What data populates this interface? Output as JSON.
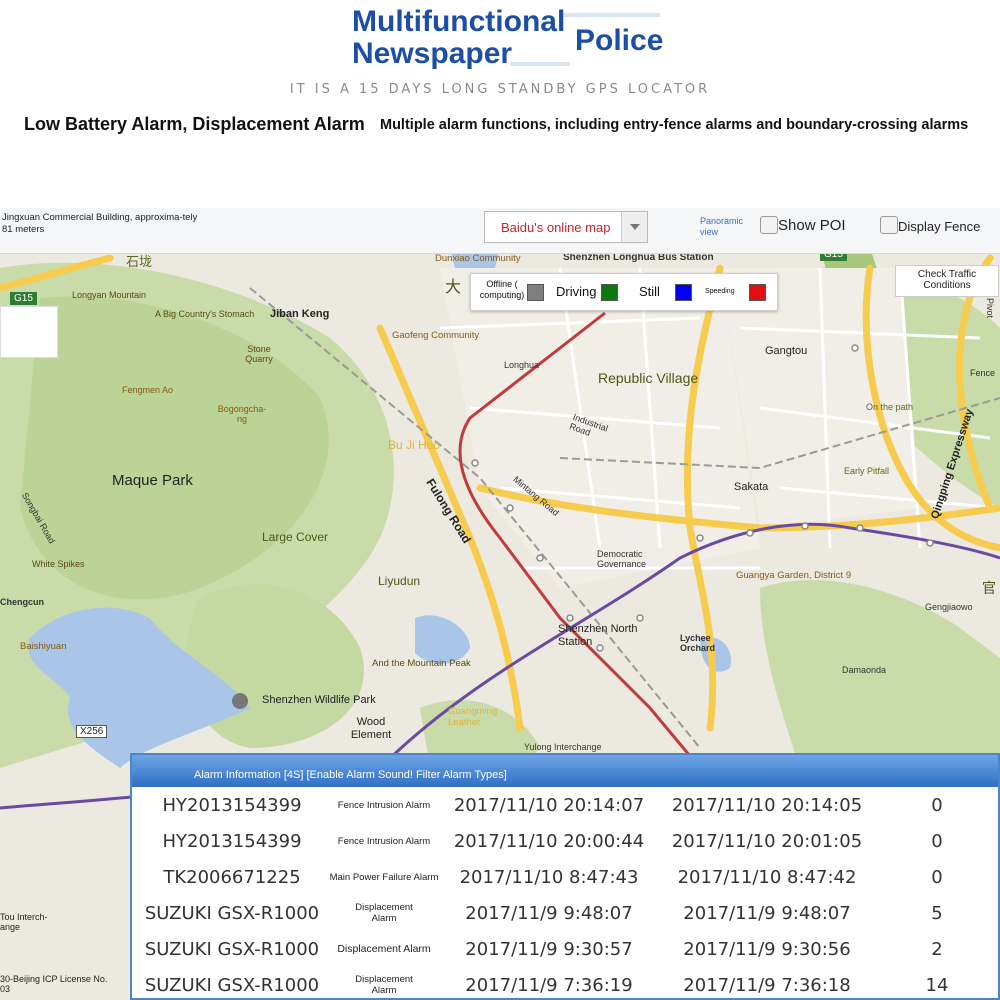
{
  "header": {
    "title_line1": "Multifunctional",
    "title_line2": "Newspaper",
    "title_police": "Police",
    "tagline": "IT IS A 15 DAYS LONG STANDBY GPS LOCATOR",
    "sub_big": "Low Battery Alarm, Displacement Alarm",
    "sub_small": "Multiple alarm functions, including entry-fence alarms and boundary-crossing alarms"
  },
  "toolbar": {
    "address": "Jingxuan Commercial Building, approxima-tely 81 meters",
    "map_select": "Baidu's online map",
    "panoramic": "Panoramic view",
    "show_poi": "Show POI",
    "display_fence": "Display Fence",
    "traffic": "Check Traffic Conditions"
  },
  "legend": {
    "offline": "Offline ( computing)",
    "driving": "Driving",
    "still": "Still",
    "speeding": "Speeding",
    "colors": {
      "offline": "#808080",
      "driving": "#0a7a10",
      "still": "#0000ee",
      "speeding": "#e01010"
    }
  },
  "map_labels": {
    "shitou": "石垅",
    "g15_left": "G15",
    "g15_right": "G15",
    "dunxiao": "Dunxiao Community",
    "longhua_bus": "Shenzhen Longhua Bus Station",
    "da": "大",
    "longyan": "Longyan Mountain",
    "stomach": "A Big Country's Stomach",
    "jiban": "Jiban Keng",
    "gaofeng": "Gaofeng Community",
    "stone": "Stone Quarry",
    "longhua": "Longhua",
    "republic": "Republic Village",
    "gangtou": "Gangtou",
    "fengmen": "Fengmen Ao",
    "bogong": "Bogongcha-ng",
    "industrial": "Industrial Road",
    "onpath": "On the path",
    "qingping": "Qingping Expressway",
    "pivot": "Pivot",
    "fence": "Fence",
    "bujihuo": "Bu Ji Huo",
    "early": "Early Pitfall",
    "maque": "Maque Park",
    "fulong": "Fulong Road",
    "mintang": "Mintang Road",
    "sakata": "Sakata",
    "songbai": "Songbai Road",
    "large_cover": "Large Cover",
    "democratic": "Democratic Governance",
    "guangya": "Guangya Garden, District 9",
    "white_spikes": "White Spikes",
    "liyudun": "Liyudun",
    "guan": "官",
    "chengcun": "Chengcun",
    "gengjiaowo": "Gengjiaowo",
    "sz_north": "Shenzhen North Station",
    "lychee": "Lychee Orchard",
    "baishiyuan": "Baishiyuan",
    "mountain_peak": "And the Mountain Peak",
    "damaonda": "Damaonda",
    "wildlife": "Shenzhen Wildlife Park",
    "guangming": "Guangming Leather",
    "x256": "X256",
    "wood": "Wood Element",
    "yulong": "Yulong Interchange",
    "tou_interchange": "Tou Interch-ange",
    "icp": "30-Beijing ICP License No. 03"
  },
  "alarm": {
    "header": "Alarm Information [4S] [Enable Alarm Sound! Filter Alarm Types]",
    "rows": [
      {
        "id": "HY2013154399",
        "type": "Fence Intrusion Alarm",
        "time1": "2017/11/10 20:14:07",
        "time2": "2017/11/10 20:14:05",
        "count": "0"
      },
      {
        "id": "HY2013154399",
        "type": "Fence Intrusion Alarm",
        "time1": "2017/11/10 20:00:44",
        "time2": "2017/11/10 20:01:05",
        "count": "0"
      },
      {
        "id": "TK2006671225",
        "type": "Main Power Failure Alarm",
        "time1": "2017/11/10 8:47:43",
        "time2": "2017/11/10 8:47:42",
        "count": "0"
      },
      {
        "id": "SUZUKI GSX-R1000",
        "type": "Displacement Alarm",
        "time1": "2017/11/9 9:48:07",
        "time2": "2017/11/9 9:48:07",
        "count": "5"
      },
      {
        "id": "SUZUKI GSX-R1000",
        "type": "Displacement Alarm",
        "time1": "2017/11/9 9:30:57",
        "time2": "2017/11/9 9:30:56",
        "count": "2"
      },
      {
        "id": "SUZUKI GSX-R1000",
        "type": "Displacement Alarm",
        "time1": "2017/11/9 7:36:19",
        "time2": "2017/11/9 7:36:18",
        "count": "14"
      }
    ]
  }
}
